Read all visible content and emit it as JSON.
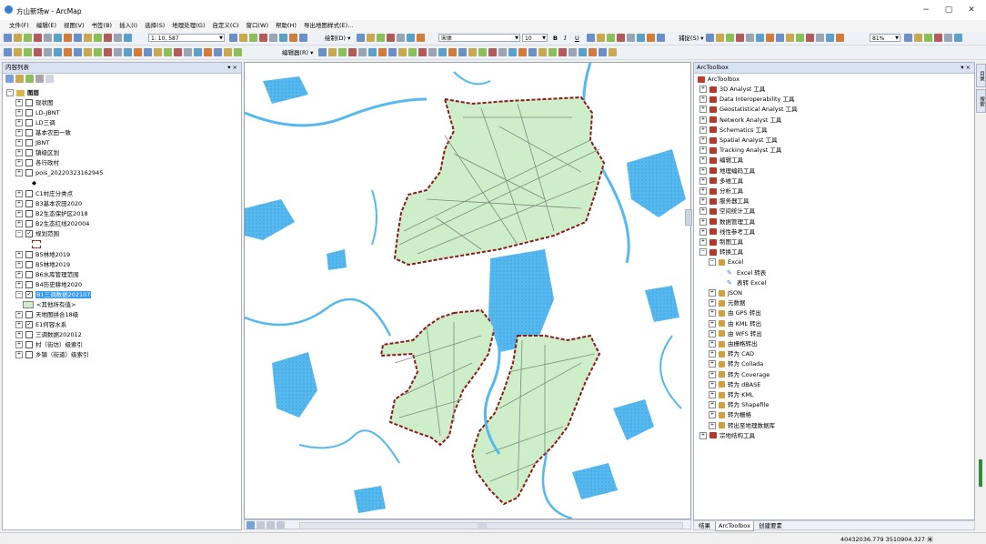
{
  "window": {
    "title": "方山新场w - ArcMap",
    "min": "−",
    "max": "▢",
    "close": "✕"
  },
  "menu": [
    "文件(F)",
    "编辑(E)",
    "视图(V)",
    "书签(B)",
    "插入(I)",
    "选择(S)",
    "地理处理(G)",
    "自定义(C)",
    "窗口(W)",
    "帮助(H)",
    "导出地图样式(E)..."
  ],
  "toolbar": {
    "scale": "1: 10, 587",
    "draw_label": "绘制(D) ▾",
    "font_name": "宋体",
    "font_size": "10",
    "bold": "B",
    "italic": "I",
    "underline": "U",
    "edit_label": "编辑器(R) ▾",
    "ruler_label": "捕捉(S) ▾",
    "zoom_percent": "81%"
  },
  "toc": {
    "title": "内容列表",
    "pin": "▾ ×",
    "group": "图层",
    "layers": [
      {
        "name": "现状图",
        "checked": false
      },
      {
        "name": "LD-JBNT",
        "checked": false
      },
      {
        "name": "LD三调",
        "checked": false
      },
      {
        "name": "基本农田一致",
        "checked": false
      },
      {
        "name": "JBNT",
        "checked": false
      },
      {
        "name": "镇级区划",
        "checked": false
      },
      {
        "name": "各行政村",
        "checked": false
      },
      {
        "name": "pois_20220323162945",
        "checked": false
      },
      {
        "name": "C1村庄分类点",
        "checked": false
      },
      {
        "name": "B3基本农田2020",
        "checked": false
      },
      {
        "name": "B2生态保护区2018",
        "checked": false
      },
      {
        "name": "B2生态红线202004",
        "checked": false
      },
      {
        "name": "规划范围",
        "checked": true
      },
      {
        "name": "B5林地2019",
        "checked": false
      },
      {
        "name": "B5林地2019",
        "checked": false
      },
      {
        "name": "B6水库管理范围",
        "checked": false
      },
      {
        "name": "B4历史耕地2020",
        "checked": false
      },
      {
        "name": "B1三调数据202107",
        "checked": true,
        "selected": true
      },
      {
        "name": "<其他所有值>",
        "legend": true
      },
      {
        "name": "天地图拼合18级",
        "checked": false
      },
      {
        "name": "E1何容水系",
        "checked": true
      },
      {
        "name": "三调数据202012",
        "checked": false
      },
      {
        "name": "村（街坊）级索引",
        "checked": false
      },
      {
        "name": "乡镇（街道）级索引",
        "checked": false
      }
    ]
  },
  "toolbox": {
    "title": "ArcToolbox",
    "pin": "▾ ×",
    "root": "ArcToolbox",
    "items": [
      {
        "label": "3D Analyst 工具",
        "level": 1
      },
      {
        "label": "Data Interoperability 工具",
        "level": 1
      },
      {
        "label": "Geostatistical Analyst 工具",
        "level": 1
      },
      {
        "label": "Network Analyst 工具",
        "level": 1
      },
      {
        "label": "Schematics 工具",
        "level": 1
      },
      {
        "label": "Spatial Analyst 工具",
        "level": 1
      },
      {
        "label": "Tracking Analyst 工具",
        "level": 1
      },
      {
        "label": "编辑工具",
        "level": 1
      },
      {
        "label": "地理编码工具",
        "level": 1
      },
      {
        "label": "多维工具",
        "level": 1
      },
      {
        "label": "分析工具",
        "level": 1
      },
      {
        "label": "服务器工具",
        "level": 1
      },
      {
        "label": "空间统计工具",
        "level": 1
      },
      {
        "label": "数据管理工具",
        "level": 1
      },
      {
        "label": "线性参考工具",
        "level": 1
      },
      {
        "label": "制图工具",
        "level": 1
      },
      {
        "label": "转换工具",
        "level": 1,
        "open": true
      },
      {
        "label": "Excel",
        "level": 2,
        "open": true
      },
      {
        "label": "Excel 转表",
        "level": 3,
        "tool": true
      },
      {
        "label": "表转 Excel",
        "level": 3,
        "tool": true
      },
      {
        "label": "JSON",
        "level": 2
      },
      {
        "label": "元数据",
        "level": 2
      },
      {
        "label": "由 GPS 转出",
        "level": 2
      },
      {
        "label": "由 KML 转出",
        "level": 2
      },
      {
        "label": "由 WFS 转出",
        "level": 2
      },
      {
        "label": "由栅格转出",
        "level": 2
      },
      {
        "label": "转为 CAD",
        "level": 2
      },
      {
        "label": "转为 Collada",
        "level": 2
      },
      {
        "label": "转为 Coverage",
        "level": 2
      },
      {
        "label": "转为 dBASE",
        "level": 2
      },
      {
        "label": "转为 KML",
        "level": 2
      },
      {
        "label": "转为 Shapefile",
        "level": 2
      },
      {
        "label": "转为栅格",
        "level": 2
      },
      {
        "label": "转出至地理数据库",
        "level": 2
      },
      {
        "label": "宗地结构工具",
        "level": 1
      }
    ],
    "tabs": [
      "结果",
      "ArcToolbox",
      "创建要素"
    ]
  },
  "right_side_tabs": [
    "目录",
    "搜索"
  ],
  "status": {
    "coords": "40432036.779  3510904.327 米"
  },
  "colors": {
    "water": "#55b9f0",
    "parcel_fill": "#cdeec8",
    "boundary": "#8b1a1a"
  }
}
